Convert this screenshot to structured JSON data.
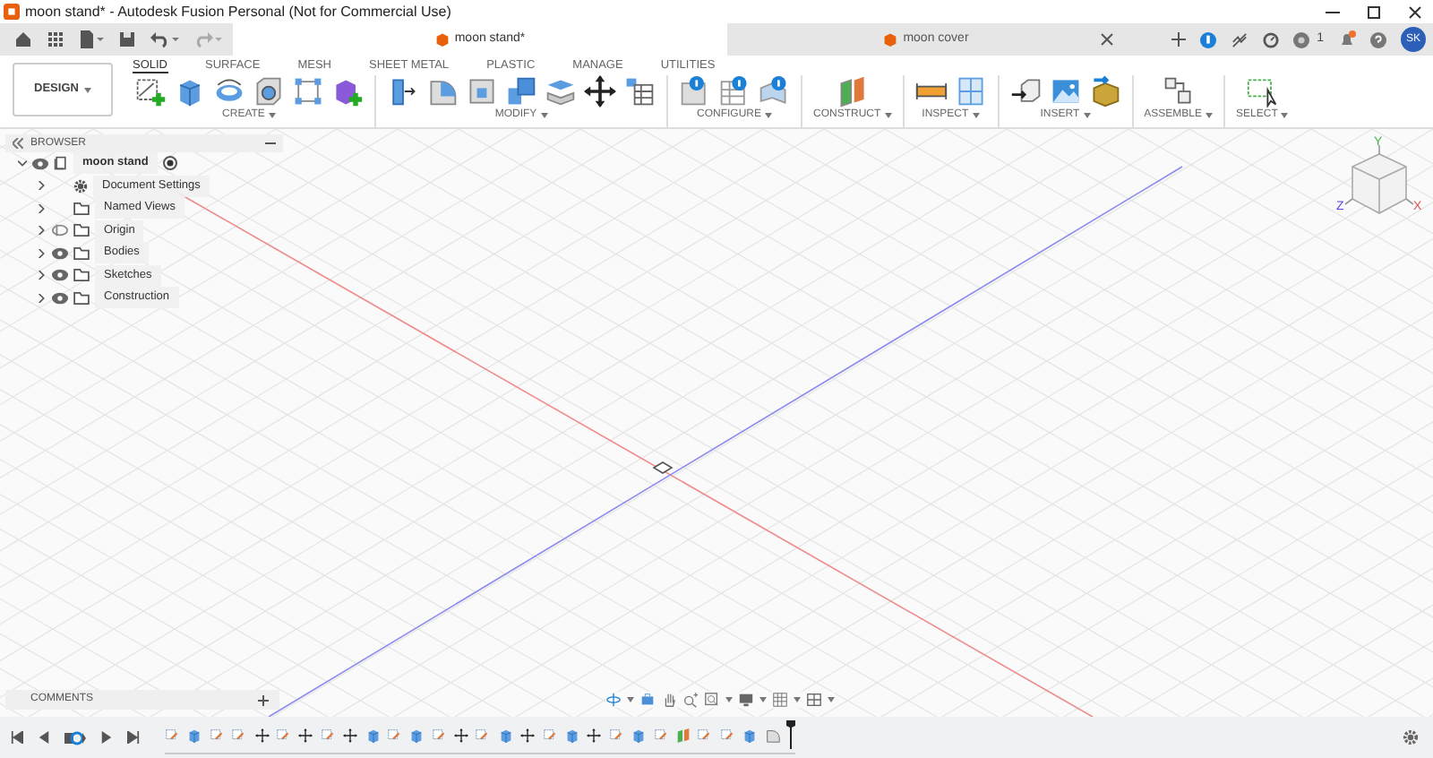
{
  "window": {
    "title": "moon stand* - Autodesk Fusion Personal (Not for Commercial Use)"
  },
  "document_tabs": [
    {
      "label": "moon stand*",
      "selected": true
    },
    {
      "label": "moon cover",
      "selected": false
    }
  ],
  "job_status": {
    "count": "1"
  },
  "notifications": {
    "unread": true
  },
  "user": {
    "initials": "SK"
  },
  "workspace": {
    "label": "DESIGN"
  },
  "toolbar_tabs": [
    {
      "label": "SOLID",
      "selected": true
    },
    {
      "label": "SURFACE",
      "selected": false
    },
    {
      "label": "MESH",
      "selected": false
    },
    {
      "label": "SHEET METAL",
      "selected": false
    },
    {
      "label": "PLASTIC",
      "selected": false
    },
    {
      "label": "MANAGE",
      "selected": false
    },
    {
      "label": "UTILITIES",
      "selected": false
    }
  ],
  "tool_groups": [
    {
      "label": "CREATE",
      "tools": [
        {
          "kind": "sketch"
        },
        {
          "kind": "extrude"
        },
        {
          "kind": "revolve"
        },
        {
          "kind": "hole"
        },
        {
          "kind": "pattern"
        },
        {
          "kind": "component"
        }
      ]
    },
    {
      "label": "MODIFY",
      "tools": [
        {
          "kind": "presspull"
        },
        {
          "kind": "fillet"
        },
        {
          "kind": "shell"
        },
        {
          "kind": "combine"
        },
        {
          "kind": "plates"
        },
        {
          "kind": "move"
        },
        {
          "kind": "table"
        }
      ]
    },
    {
      "label": "CONFIGURE",
      "tools": [
        {
          "kind": "configure"
        },
        {
          "kind": "configtable"
        },
        {
          "kind": "configtheme"
        }
      ]
    },
    {
      "label": "CONSTRUCT",
      "tools": [
        {
          "kind": "plane"
        }
      ]
    },
    {
      "label": "INSPECT",
      "tools": [
        {
          "kind": "measure"
        },
        {
          "kind": "section"
        }
      ]
    },
    {
      "label": "INSERT",
      "tools": [
        {
          "kind": "insert"
        },
        {
          "kind": "image"
        },
        {
          "kind": "mesh"
        }
      ]
    },
    {
      "label": "ASSEMBLE",
      "tools": [
        {
          "kind": "joint"
        }
      ]
    },
    {
      "label": "SELECT",
      "tools": [
        {
          "kind": "select"
        }
      ]
    }
  ],
  "browser": {
    "title": "BROWSER",
    "root": {
      "label": "moon stand",
      "kind": "component",
      "expanded": true,
      "visible": true,
      "active": true,
      "children": [
        {
          "label": "Document Settings",
          "kind": "settings",
          "expanded": false
        },
        {
          "label": "Named Views",
          "kind": "folder",
          "expanded": false
        },
        {
          "label": "Origin",
          "kind": "folder",
          "expanded": false,
          "visible": false
        },
        {
          "label": "Bodies",
          "kind": "folder",
          "expanded": false,
          "visible": true
        },
        {
          "label": "Sketches",
          "kind": "folder",
          "expanded": false,
          "visible": true
        },
        {
          "label": "Construction",
          "kind": "folder",
          "expanded": false,
          "visible": true
        }
      ]
    }
  },
  "viewcube": {
    "axis_labels": [
      {
        "kind": "y",
        "label": "Y"
      },
      {
        "kind": "z",
        "label": "Z"
      },
      {
        "kind": "x",
        "label": "X"
      }
    ]
  },
  "comments": {
    "title": "COMMENTS"
  },
  "navigation_tools": [
    {
      "kind": "orbit"
    },
    {
      "kind": "look"
    },
    {
      "kind": "pan"
    },
    {
      "kind": "zoom"
    },
    {
      "kind": "fit"
    },
    {
      "kind": "display"
    },
    {
      "kind": "grid"
    },
    {
      "kind": "viewports"
    }
  ],
  "timeline": {
    "features": [
      {
        "kind": "sketch"
      },
      {
        "kind": "extrude"
      },
      {
        "kind": "sketch"
      },
      {
        "kind": "sketch"
      },
      {
        "kind": "move"
      },
      {
        "kind": "sketch"
      },
      {
        "kind": "move"
      },
      {
        "kind": "sketch"
      },
      {
        "kind": "move"
      },
      {
        "kind": "extrude"
      },
      {
        "kind": "sketch"
      },
      {
        "kind": "extrude"
      },
      {
        "kind": "sketch"
      },
      {
        "kind": "move"
      },
      {
        "kind": "sketch"
      },
      {
        "kind": "extrude"
      },
      {
        "kind": "move"
      },
      {
        "kind": "sketch"
      },
      {
        "kind": "extrude"
      },
      {
        "kind": "move"
      },
      {
        "kind": "sketch"
      },
      {
        "kind": "extrude"
      },
      {
        "kind": "sketch"
      },
      {
        "kind": "plane"
      },
      {
        "kind": "sketch"
      },
      {
        "kind": "sketch"
      },
      {
        "kind": "extrude"
      },
      {
        "kind": "fillet"
      }
    ]
  }
}
